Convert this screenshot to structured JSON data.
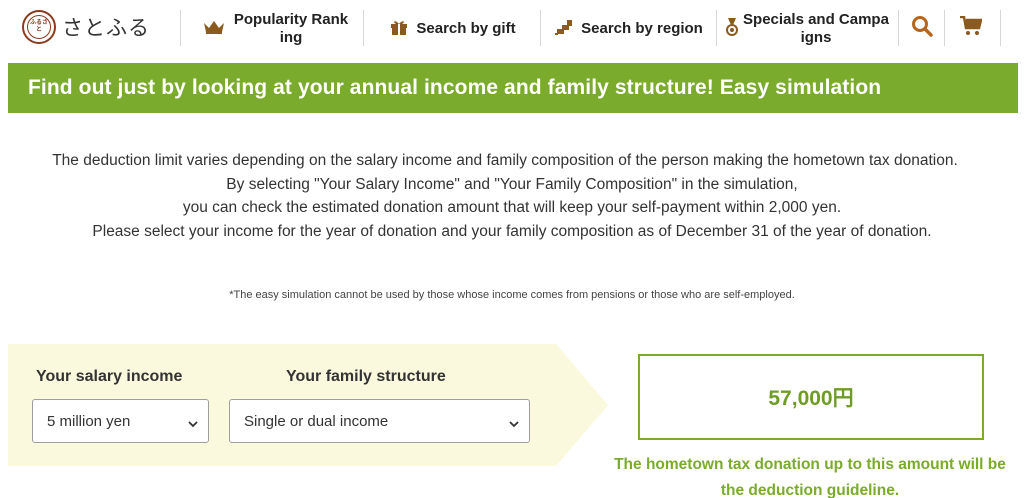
{
  "header": {
    "logo_mark": "ふるさと",
    "logo_text": "さとふる",
    "nav": [
      {
        "label": "Popularity Ranking",
        "icon": "crown-icon"
      },
      {
        "label": "Search by gift",
        "icon": "gift-icon"
      },
      {
        "label": "Search by region",
        "icon": "region-map-icon"
      },
      {
        "label": "Specials and Campaigns",
        "icon": "medal-icon"
      }
    ],
    "search_icon": "search-icon",
    "cart_icon": "cart-icon"
  },
  "banner": {
    "title": "Find out just by looking at your annual income and family structure! Easy simulation"
  },
  "description": {
    "line1": "The deduction limit varies depending on the salary income and family composition of the person making the hometown tax donation.",
    "line2": "By selecting \"Your Salary Income\" and \"Your Family Composition\" in the simulation,",
    "line3": "you can check the estimated donation amount that will keep your self-payment within 2,000 yen.",
    "line4": "Please select your income for the year of donation and your family composition as of December 31 of the year of donation.",
    "note": "*The easy simulation cannot be used by those whose income comes from pensions or those who are self-employed."
  },
  "simulation": {
    "income_label": "Your salary income",
    "income_value": "5 million yen",
    "family_label": "Your family structure",
    "family_value": "Single or dual income"
  },
  "result": {
    "amount": "57,000円",
    "caption": "The hometown tax donation up to this amount will be the deduction guideline."
  },
  "colors": {
    "accent_green": "#7aab2d",
    "panel_yellow": "#fbf9dd",
    "icon_brown": "#8b5a1e",
    "search_orange": "#b5651d"
  }
}
